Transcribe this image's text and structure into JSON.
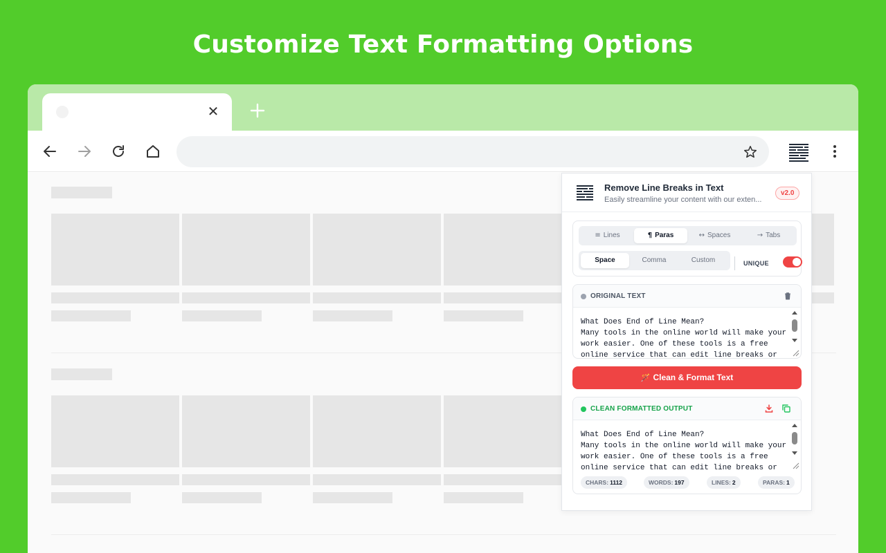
{
  "banner": {
    "headline": "Customize Text Formatting Options"
  },
  "browser": {
    "tab": {
      "close_glyph": "✕"
    },
    "toolbar": {
      "icons": [
        "back-icon",
        "forward-icon",
        "reload-icon",
        "home-icon",
        "bookmark-star-icon",
        "extension-icon",
        "menu-kebab-icon"
      ]
    }
  },
  "popup": {
    "title": "Remove Line Breaks in Text",
    "subtitle": "Easily streamline your content with our exten...",
    "version": "v2.0",
    "mode_tabs": [
      {
        "glyph": "≡",
        "label": "Lines",
        "active": false
      },
      {
        "glyph": "¶",
        "label": "Paras",
        "active": true
      },
      {
        "glyph": "↔",
        "label": "Spaces",
        "active": false
      },
      {
        "glyph": "→",
        "label": "Tabs",
        "active": false
      }
    ],
    "separator_tabs": [
      {
        "label": "Space",
        "active": true
      },
      {
        "label": "Comma",
        "active": false
      },
      {
        "label": "Custom",
        "active": false
      }
    ],
    "unique_label": "UNIQUE",
    "unique_enabled": true,
    "original": {
      "label": "ORIGINAL TEXT",
      "text": "What Does End of Line Mean?\nMany tools in the online world will make your work easier. One of these tools is a free online service that can edit line breaks or"
    },
    "action_button": {
      "glyph": "🪄",
      "label": "Clean & Format Text"
    },
    "output": {
      "label": "CLEAN FORMATTED OUTPUT",
      "text": "What Does End of Line Mean?\nMany tools in the online world will make your work easier. One of these tools is a free online service that can edit line breaks or"
    },
    "stats": {
      "chars_label": "CHARS:",
      "chars": "1112",
      "words_label": "WORDS:",
      "words": "197",
      "lines_label": "LINES:",
      "lines": "2",
      "paras_label": "PARAS:",
      "paras": "1"
    },
    "colors": {
      "accent": "#ef4444",
      "ok": "#22c55e",
      "neutral_dot": "#9ca3af"
    }
  }
}
